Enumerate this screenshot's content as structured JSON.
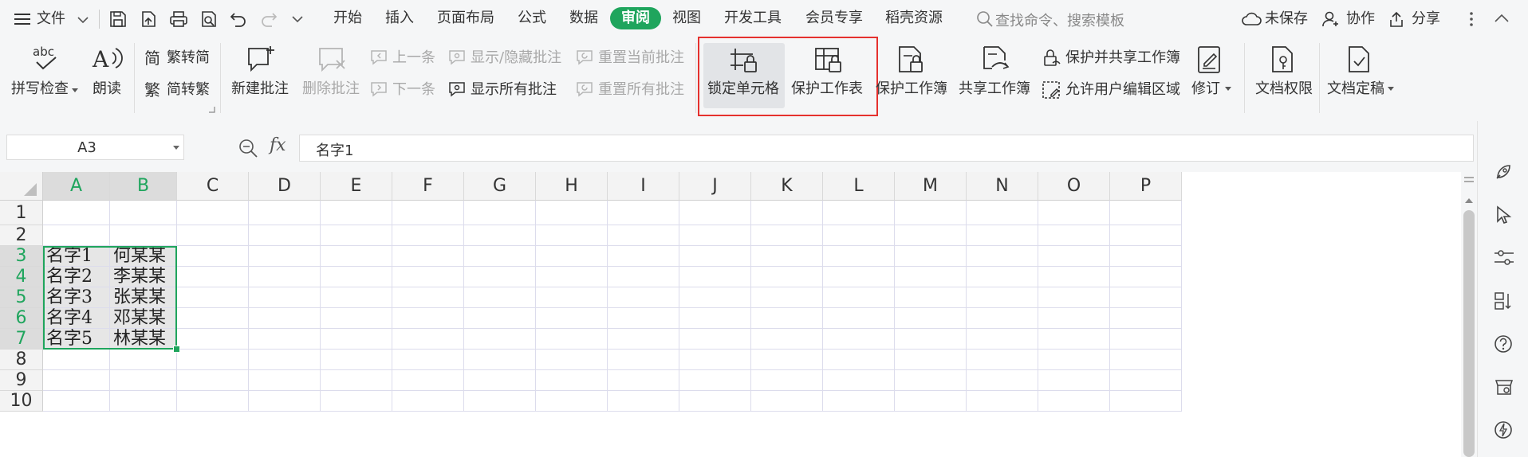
{
  "menubar": {
    "file_label": "文件",
    "tabs": [
      {
        "label": "开始",
        "active": false
      },
      {
        "label": "插入",
        "active": false
      },
      {
        "label": "页面布局",
        "active": false
      },
      {
        "label": "公式",
        "active": false
      },
      {
        "label": "数据",
        "active": false
      },
      {
        "label": "审阅",
        "active": true
      },
      {
        "label": "视图",
        "active": false
      },
      {
        "label": "开发工具",
        "active": false
      },
      {
        "label": "会员专享",
        "active": false
      },
      {
        "label": "稻壳资源",
        "active": false
      }
    ],
    "search_placeholder": "查找命令、搜索模板",
    "unsaved_label": "未保存",
    "collab_label": "协作",
    "share_label": "分享",
    "accent_color": "#1fa55d"
  },
  "ribbon": {
    "spell_check": "拼写检查",
    "read_aloud": "朗读",
    "trad_to_simp": "繁转简",
    "simp_to_trad": "简转繁",
    "new_comment": "新建批注",
    "delete_comment": "删除批注",
    "prev_comment": "上一条",
    "next_comment": "下一条",
    "toggle_comments": "显示/隐藏批注",
    "show_all_comments": "显示所有批注",
    "reset_current_comment": "重置当前批注",
    "reset_all_comments": "重置所有批注",
    "lock_cells": "锁定单元格",
    "protect_sheet": "保护工作表",
    "protect_workbook": "保护工作簿",
    "share_workbook": "共享工作簿",
    "protect_and_share": "保护并共享工作簿",
    "allow_edit_ranges": "允许用户编辑区域",
    "track_changes": "修订",
    "doc_permissions": "文档权限",
    "doc_finalize": "文档定稿",
    "highlight_color": "#e5312e"
  },
  "formula_bar": {
    "cell_ref": "A3",
    "formula_value": "名字1",
    "fx_label": "fx"
  },
  "sheet": {
    "columns": [
      "A",
      "B",
      "C",
      "D",
      "E",
      "F",
      "G",
      "H",
      "I",
      "J",
      "K",
      "L",
      "M",
      "N",
      "O",
      "P"
    ],
    "selected_columns": [
      "A",
      "B"
    ],
    "rows": [
      "1",
      "2",
      "3",
      "4",
      "5",
      "6",
      "7",
      "8",
      "9",
      "10"
    ],
    "selected_rows": [
      "3",
      "4",
      "5",
      "6",
      "7"
    ],
    "cells": {
      "A3": "名字1",
      "B3": "何某某",
      "A4": "名字2",
      "B4": "李某某",
      "A5": "名字3",
      "B5": "张某某",
      "A6": "名字4",
      "B6": "邓某某",
      "A7": "名字5",
      "B7": "林某某"
    }
  }
}
